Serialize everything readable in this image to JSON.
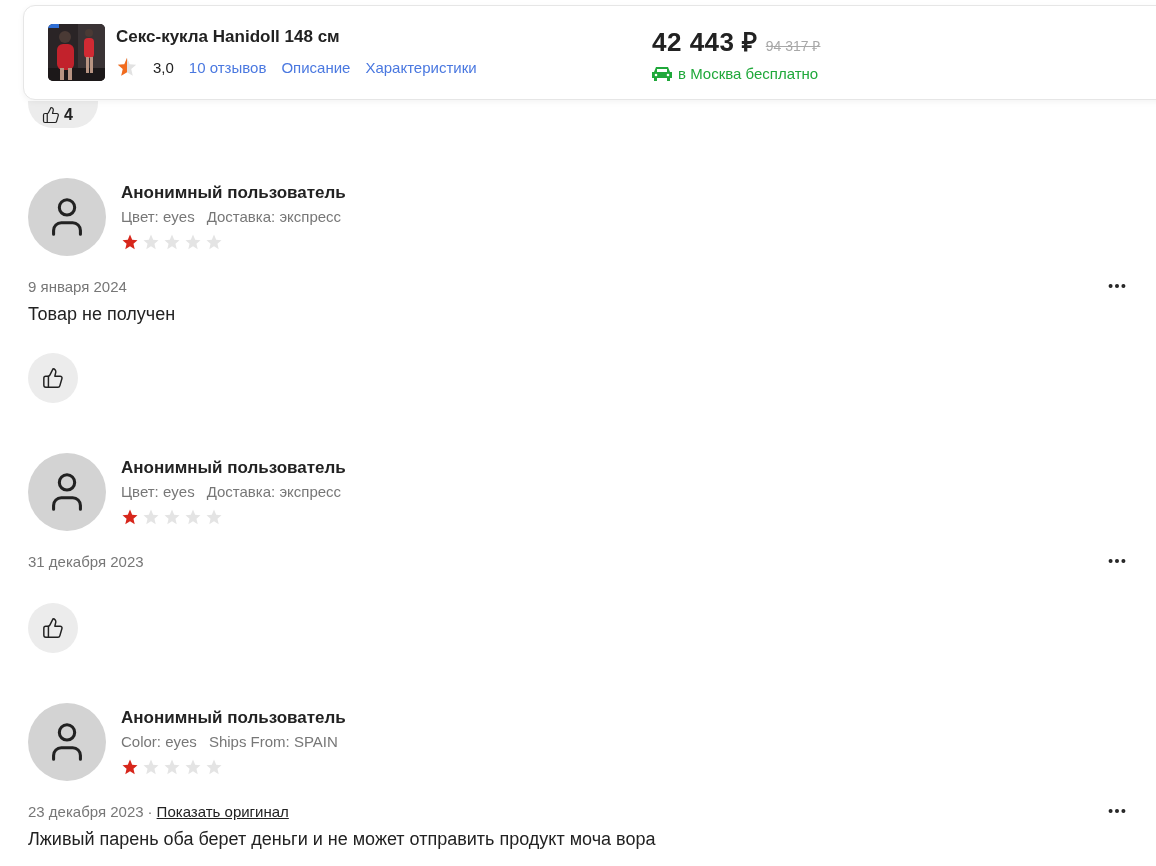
{
  "header": {
    "product_title": "Секс-кукла Hanidoll 148 см",
    "rating": "3,0",
    "links": [
      "10 отзывов",
      "Описание",
      "Характеристики"
    ],
    "price": "42 443 ₽",
    "old_price": "94 317 ₽",
    "delivery": "в Москва бесплатно"
  },
  "top_like": {
    "count": "4"
  },
  "reviews": [
    {
      "author": "Анонимный пользователь",
      "attributes": [
        "Цвет: eyes",
        "Доставка: экспресс"
      ],
      "stars": 1,
      "date": "9 января 2024",
      "text": "Товар не получен"
    },
    {
      "author": "Анонимный пользователь",
      "attributes": [
        "Цвет: eyes",
        "Доставка: экспресс"
      ],
      "stars": 1,
      "date": "31 декабря 2023"
    },
    {
      "author": "Анонимный пользователь",
      "attributes": [
        "Color: eyes",
        "Ships From: SPAIN"
      ],
      "stars": 1,
      "date": "23 декабря 2023",
      "separator": "·",
      "show_original": "Показать оригинал",
      "text": "Лживый парень оба берет деньги и не может отправить продукт моча вора"
    }
  ]
}
